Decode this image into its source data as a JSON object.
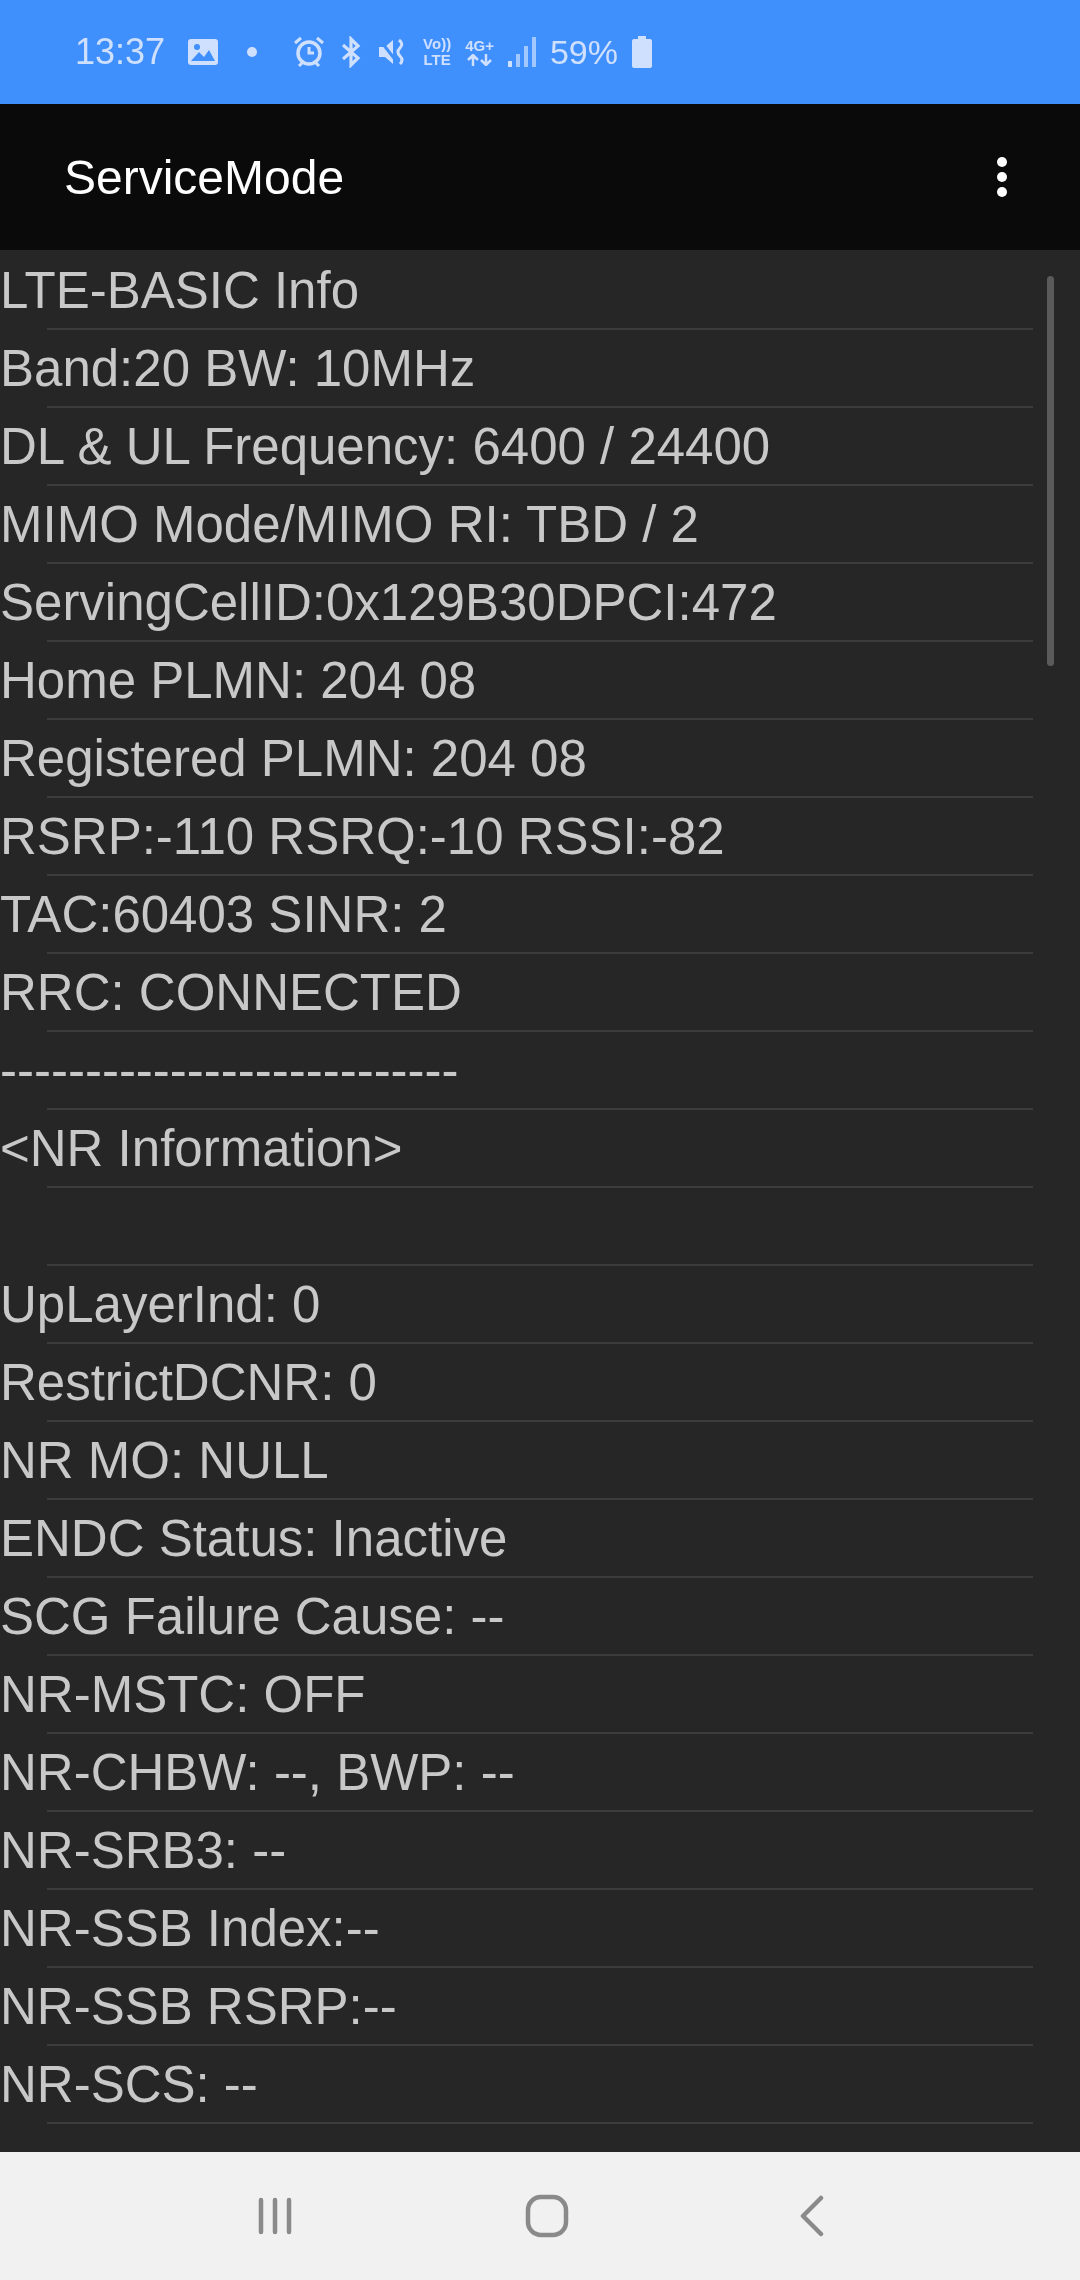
{
  "status_bar": {
    "time": "13:37",
    "volte": {
      "top": "Vo))",
      "bottom": "LTE"
    },
    "network": "4G+",
    "battery": "59%"
  },
  "app_bar": {
    "title": "ServiceMode"
  },
  "rows": [
    {
      "kind": "text",
      "text": "LTE-BASIC Info"
    },
    {
      "kind": "text",
      "text": "Band:20 BW: 10MHz"
    },
    {
      "kind": "text",
      "text": "DL & UL Frequency: 6400 / 24400"
    },
    {
      "kind": "text",
      "text": "MIMO Mode/MIMO RI: TBD / 2"
    },
    {
      "kind": "text",
      "text": "ServingCellID:0x129B30DPCI:472"
    },
    {
      "kind": "text",
      "text": "Home PLMN: 204 08"
    },
    {
      "kind": "text",
      "text": "Registered PLMN: 204 08"
    },
    {
      "kind": "text",
      "text": "RSRP:-110 RSRQ:-10 RSSI:-82"
    },
    {
      "kind": "text",
      "text": "TAC:60403 SINR: 2"
    },
    {
      "kind": "text",
      "text": "RRC: CONNECTED"
    },
    {
      "kind": "text",
      "text": "---------------------------"
    },
    {
      "kind": "text",
      "text": "<NR Information>"
    },
    {
      "kind": "blank"
    },
    {
      "kind": "text",
      "text": "UpLayerInd: 0"
    },
    {
      "kind": "text",
      "text": "RestrictDCNR: 0"
    },
    {
      "kind": "text",
      "text": "NR MO: NULL"
    },
    {
      "kind": "text",
      "text": "ENDC Status: Inactive"
    },
    {
      "kind": "text",
      "text": "SCG Failure Cause: --"
    },
    {
      "kind": "text",
      "text": "NR-MSTC: OFF"
    },
    {
      "kind": "text",
      "text": "NR-CHBW: --, BWP: --"
    },
    {
      "kind": "text",
      "text": "NR-SRB3: --"
    },
    {
      "kind": "text",
      "text": "NR-SSB Index:--"
    },
    {
      "kind": "text",
      "text": "NR-SSB RSRP:--"
    },
    {
      "kind": "text",
      "text": "NR-SCS: --"
    }
  ]
}
